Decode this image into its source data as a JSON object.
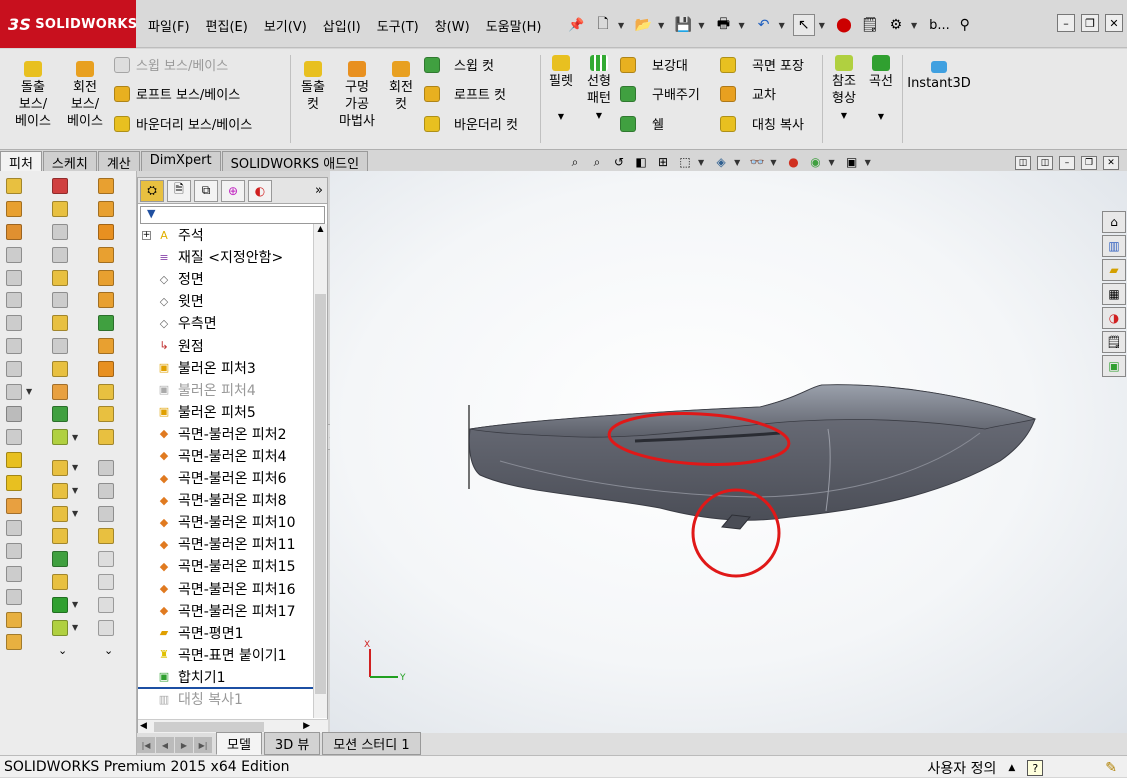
{
  "app": {
    "logo": "SOLIDWORKS",
    "logo_mark": "3S",
    "doc_title": "b..."
  },
  "menu": [
    "파일(F)",
    "편집(E)",
    "보기(V)",
    "삽입(I)",
    "도구(T)",
    "창(W)",
    "도움말(H)"
  ],
  "ribbon": {
    "extrude_boss": [
      "돌출",
      "보스/",
      "베이스"
    ],
    "revolve_boss": [
      "회전",
      "보스/",
      "베이스"
    ],
    "swept_boss": "스윕 보스/베이스",
    "loft_boss": "로프트 보스/베이스",
    "boundary_boss": "바운더리 보스/베이스",
    "extrude_cut": [
      "돌출",
      "컷"
    ],
    "hole_wizard": [
      "구멍",
      "가공",
      "마법사"
    ],
    "revolve_cut": [
      "회전",
      "컷"
    ],
    "swept_cut": "스윕 컷",
    "loft_cut": "로프트 컷",
    "boundary_cut": "바운더리 컷",
    "fillet": "필렛",
    "linear_pattern": [
      "선형",
      "패턴"
    ],
    "rib": "보강대",
    "draft": "구배주기",
    "shell": "쉘",
    "wrap": "곡면 포장",
    "intersect": "교차",
    "mirror": "대칭 복사",
    "ref_geometry": [
      "참조",
      "형상"
    ],
    "curves": "곡선",
    "instant3d": "Instant3D"
  },
  "cmd_tabs": [
    "피처",
    "스케치",
    "계산",
    "DimXpert",
    "SOLIDWORKS 애드인"
  ],
  "tree": [
    {
      "label": "주석",
      "icon": "A",
      "color": "#e0b000",
      "dim": false,
      "exp": true
    },
    {
      "label": "재질 <지정안함>",
      "icon": "≡",
      "color": "#8844aa",
      "dim": false,
      "exp": false
    },
    {
      "label": "정면",
      "icon": "◇",
      "color": "#666",
      "dim": false,
      "exp": false
    },
    {
      "label": "윗면",
      "icon": "◇",
      "color": "#666",
      "dim": false,
      "exp": false
    },
    {
      "label": "우측면",
      "icon": "◇",
      "color": "#666",
      "dim": false,
      "exp": false
    },
    {
      "label": "원점",
      "icon": "↳",
      "color": "#c03030",
      "dim": false,
      "exp": false
    },
    {
      "label": "불러온 피처3",
      "icon": "▣",
      "color": "#e0a000",
      "dim": false,
      "exp": false
    },
    {
      "label": "불러온 피처4",
      "icon": "▣",
      "color": "#aaaaaa",
      "dim": true,
      "exp": false
    },
    {
      "label": "불러온 피처5",
      "icon": "▣",
      "color": "#e0a000",
      "dim": false,
      "exp": false
    },
    {
      "label": "곡면-불러온 피처2",
      "icon": "◆",
      "color": "#e07a20",
      "dim": false,
      "exp": false
    },
    {
      "label": "곡면-불러온 피처4",
      "icon": "◆",
      "color": "#e07a20",
      "dim": false,
      "exp": false
    },
    {
      "label": "곡면-불러온 피처6",
      "icon": "◆",
      "color": "#e07a20",
      "dim": false,
      "exp": false
    },
    {
      "label": "곡면-불러온 피처8",
      "icon": "◆",
      "color": "#e07a20",
      "dim": false,
      "exp": false
    },
    {
      "label": "곡면-불러온 피처10",
      "icon": "◆",
      "color": "#e07a20",
      "dim": false,
      "exp": false
    },
    {
      "label": "곡면-불러온 피처11",
      "icon": "◆",
      "color": "#e07a20",
      "dim": false,
      "exp": false
    },
    {
      "label": "곡면-불러온 피처15",
      "icon": "◆",
      "color": "#e07a20",
      "dim": false,
      "exp": false
    },
    {
      "label": "곡면-불러온 피처16",
      "icon": "◆",
      "color": "#e07a20",
      "dim": false,
      "exp": false
    },
    {
      "label": "곡면-불러온 피처17",
      "icon": "◆",
      "color": "#e07a20",
      "dim": false,
      "exp": false
    },
    {
      "label": "곡면-평면1",
      "icon": "▰",
      "color": "#e0a000",
      "dim": false,
      "exp": false
    },
    {
      "label": "곡면-표면 붙이기1",
      "icon": "♜",
      "color": "#e0c000",
      "dim": false,
      "exp": false
    },
    {
      "label": "합치기1",
      "icon": "▣",
      "color": "#30a030",
      "dim": false,
      "exp": false
    },
    {
      "label": "대칭 복사1",
      "icon": "▥",
      "color": "#aaaaaa",
      "dim": true,
      "exp": false
    }
  ],
  "bottom_tabs": [
    "모델",
    "3D 뷰",
    "모션 스터디 1"
  ],
  "status": {
    "left": "SOLIDWORKS Premium 2015 x64 Edition",
    "units": "사용자 정의",
    "help": "?"
  },
  "triad": {
    "x": "X",
    "y": "Y"
  },
  "colors": {
    "accent": "#c8101e",
    "model": "#6e717c",
    "highlight_circle": "#e01818",
    "rollback_bar": "#1c4fa3"
  }
}
